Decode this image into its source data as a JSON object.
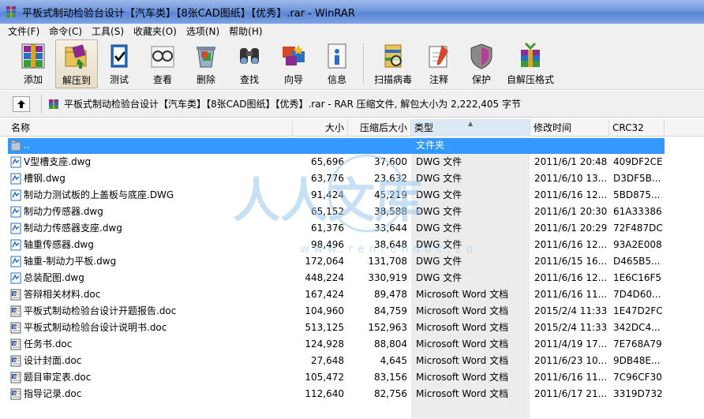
{
  "window": {
    "title": "平板式制动检验台设计【汽车类】【8张CAD图纸】【优秀】.rar - WinRAR"
  },
  "menu": [
    "文件(F)",
    "命令(C)",
    "工具(S)",
    "收藏夹(O)",
    "选项(N)",
    "帮助(H)"
  ],
  "toolbar": [
    {
      "label": "添加",
      "icon": "add-archive-icon"
    },
    {
      "label": "解压到",
      "icon": "extract-to-icon",
      "active": true
    },
    {
      "label": "测试",
      "icon": "test-icon"
    },
    {
      "label": "查看",
      "icon": "view-icon"
    },
    {
      "label": "删除",
      "icon": "delete-icon"
    },
    {
      "label": "查找",
      "icon": "find-icon"
    },
    {
      "label": "向导",
      "icon": "wizard-icon"
    },
    {
      "label": "信息",
      "icon": "info-icon"
    },
    {
      "label": "扫描病毒",
      "icon": "virus-scan-icon"
    },
    {
      "label": "注释",
      "icon": "comment-icon"
    },
    {
      "label": "保护",
      "icon": "protect-icon"
    },
    {
      "label": "自解压格式",
      "icon": "sfx-icon"
    }
  ],
  "address": {
    "text": "平板式制动检验台设计【汽车类】【8张CAD图纸】【优秀】.rar - RAR 压缩文件, 解包大小为 2,222,405 字节"
  },
  "columns": {
    "name": "名称",
    "size": "大小",
    "packed": "压缩后大小",
    "type": "类型",
    "modified": "修改时间",
    "crc": "CRC32"
  },
  "files": [
    {
      "name": "..",
      "size": "",
      "packed": "",
      "type": "文件夹",
      "modified": "",
      "crc": "",
      "kind": "folder",
      "selected": true
    },
    {
      "name": "V型槽支座.dwg",
      "size": "65,696",
      "packed": "37,600",
      "type": "DWG 文件",
      "modified": "2011/6/1 20:48",
      "crc": "409DF2CE",
      "kind": "dwg"
    },
    {
      "name": "槽钢.dwg",
      "size": "63,776",
      "packed": "23,632",
      "type": "DWG 文件",
      "modified": "2011/6/10 13...",
      "crc": "D3DF5B...",
      "kind": "dwg"
    },
    {
      "name": "制动力测试板的上盖板与底座.DWG",
      "size": "91,424",
      "packed": "45,219",
      "type": "DWG 文件",
      "modified": "2011/6/16 12...",
      "crc": "5BD875...",
      "kind": "dwg"
    },
    {
      "name": "制动力传感器.dwg",
      "size": "65,152",
      "packed": "38,588",
      "type": "DWG 文件",
      "modified": "2011/6/1 20:30",
      "crc": "61A33386",
      "kind": "dwg"
    },
    {
      "name": "制动力传感器支座.dwg",
      "size": "61,376",
      "packed": "33,644",
      "type": "DWG 文件",
      "modified": "2011/6/1 20:29",
      "crc": "72F487DC",
      "kind": "dwg"
    },
    {
      "name": "轴重传感器.dwg",
      "size": "98,496",
      "packed": "38,648",
      "type": "DWG 文件",
      "modified": "2011/6/16 12...",
      "crc": "93A2E008",
      "kind": "dwg"
    },
    {
      "name": "轴重-制动力平板.dwg",
      "size": "172,064",
      "packed": "131,708",
      "type": "DWG 文件",
      "modified": "2011/6/15 16...",
      "crc": "D465B5...",
      "kind": "dwg"
    },
    {
      "name": "总装配图.dwg",
      "size": "448,224",
      "packed": "330,919",
      "type": "DWG 文件",
      "modified": "2011/6/16 12...",
      "crc": "1E6C16F5",
      "kind": "dwg"
    },
    {
      "name": "答辩相关材料.doc",
      "size": "167,424",
      "packed": "89,478",
      "type": "Microsoft Word 文档",
      "modified": "2011/6/16 11...",
      "crc": "7D4D60...",
      "kind": "doc"
    },
    {
      "name": "平板式制动检验台设计开题报告.doc",
      "size": "104,960",
      "packed": "84,759",
      "type": "Microsoft Word 文档",
      "modified": "2015/2/4 11:33",
      "crc": "1E47D2FC",
      "kind": "doc"
    },
    {
      "name": "平板式制动检验台设计说明书.doc",
      "size": "513,125",
      "packed": "152,963",
      "type": "Microsoft Word 文档",
      "modified": "2015/2/4 11:33",
      "crc": "342DC4...",
      "kind": "doc"
    },
    {
      "name": "任务书.doc",
      "size": "124,928",
      "packed": "88,804",
      "type": "Microsoft Word 文档",
      "modified": "2011/4/19 17...",
      "crc": "7E768A79",
      "kind": "doc"
    },
    {
      "name": "设计封面.doc",
      "size": "27,648",
      "packed": "4,645",
      "type": "Microsoft Word 文档",
      "modified": "2011/6/23 10...",
      "crc": "9DB48E...",
      "kind": "doc"
    },
    {
      "name": "题目审定表.doc",
      "size": "105,472",
      "packed": "83,156",
      "type": "Microsoft Word 文档",
      "modified": "2011/6/16 11...",
      "crc": "7C96CF30",
      "kind": "doc"
    },
    {
      "name": "指导记录.doc",
      "size": "112,640",
      "packed": "82,756",
      "type": "Microsoft Word 文档",
      "modified": "2011/6/17 21...",
      "crc": "3319D732",
      "kind": "doc"
    }
  ],
  "colors": {
    "selection": "#3399ff",
    "titlebar": "#6f97dc",
    "watermark": "#6fb0e0"
  }
}
